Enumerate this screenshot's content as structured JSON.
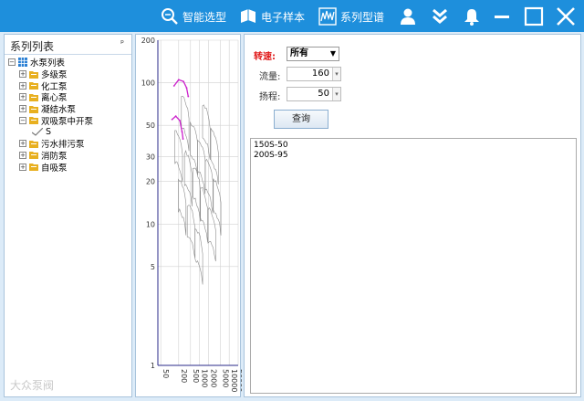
{
  "topbar": {
    "nav": [
      {
        "label": "智能选型",
        "icon": "zoom-search-icon"
      },
      {
        "label": "电子样本",
        "icon": "book-icon"
      },
      {
        "label": "系列型谱",
        "icon": "spectrum-chart-icon"
      }
    ],
    "window_icons": [
      "user-icon",
      "double-chevron-down-icon",
      "bell-icon",
      "minimize-icon",
      "maximize-icon",
      "close-icon"
    ],
    "colors": {
      "bar": "#1e8fdc",
      "icon": "#ffffff"
    }
  },
  "left_panel": {
    "title": "系列列表",
    "pin": "ᵖ",
    "tree": {
      "root": "水泵列表",
      "items": [
        {
          "label": "多级泵",
          "expander": "+"
        },
        {
          "label": "化工泵",
          "expander": "+"
        },
        {
          "label": "离心泵",
          "expander": "+"
        },
        {
          "label": "凝结水泵",
          "expander": "+"
        },
        {
          "label": "双吸泵中开泵",
          "expander": "−"
        },
        {
          "label": "S",
          "child": true
        },
        {
          "label": "污水排污泵",
          "expander": "+"
        },
        {
          "label": "消防泵",
          "expander": "+"
        },
        {
          "label": "自吸泵",
          "expander": "+"
        }
      ]
    },
    "watermark": "大众泵阀"
  },
  "chart_data": {
    "type": "line",
    "scale": "log-log",
    "y_ticks": [
      1,
      5,
      10,
      20,
      30,
      50,
      100,
      200
    ],
    "x_ticks": [
      50,
      200,
      500,
      1000,
      2000,
      5000,
      10000,
      20000
    ],
    "x_tick_labels": [
      "50",
      "200",
      "500",
      "1000",
      "2000",
      "5000",
      "10000",
      "20000"
    ],
    "ylim": [
      1,
      200
    ],
    "xlim": [
      40,
      20000
    ],
    "grid": true,
    "colors": {
      "highlight": "#cc22cc",
      "curves": "#8c8c8c",
      "axis": "#2a2a8a",
      "grid": "#d2d2d2"
    },
    "highlight_series": [
      {
        "name": "150S-50",
        "points": [
          [
            120,
            55
          ],
          [
            160,
            58
          ],
          [
            220,
            54
          ],
          [
            260,
            45
          ],
          [
            280,
            40
          ]
        ]
      },
      {
        "name": "200S-95",
        "points": [
          [
            140,
            95
          ],
          [
            200,
            105
          ],
          [
            290,
            102
          ],
          [
            370,
            92
          ],
          [
            420,
            80
          ]
        ]
      }
    ]
  },
  "right_panel": {
    "speed": {
      "label": "转速:",
      "value": "所有"
    },
    "flow": {
      "label": "流量:",
      "value": "160"
    },
    "head": {
      "label": "扬程:",
      "value": "50"
    },
    "query_button": "查询",
    "results": [
      "150S-50",
      "200S-95"
    ]
  }
}
